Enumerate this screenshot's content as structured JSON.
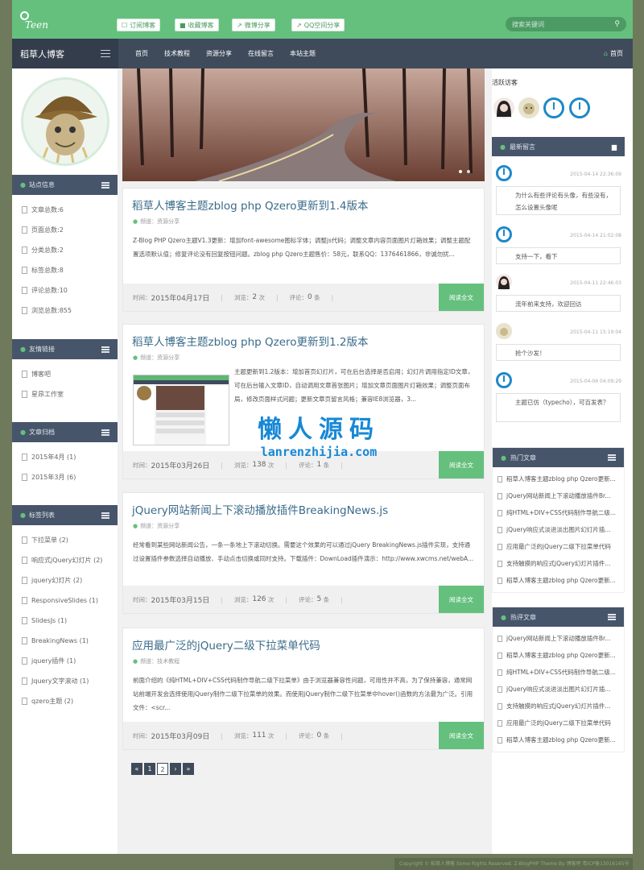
{
  "header": {
    "logo_text": "Teen",
    "buttons": [
      {
        "icon": "rss-icon",
        "label": "订阅博客"
      },
      {
        "icon": "bookmark-icon",
        "label": "收藏博客"
      },
      {
        "icon": "share-icon",
        "label": "微博分享"
      },
      {
        "icon": "share-icon",
        "label": "QQ空间分享"
      }
    ],
    "search_placeholder": "搜索关键词"
  },
  "nav": {
    "brand": "稻草人博客",
    "items": [
      "首页",
      "技术教程",
      "资源分享",
      "在线留言",
      "本站主题"
    ],
    "home": "首页"
  },
  "sidebar_left": {
    "site_info": {
      "title": "站点信息",
      "items": [
        "文章总数:6",
        "页面总数:2",
        "分类总数:2",
        "标签总数:8",
        "评论总数:10",
        "浏览总数:855"
      ]
    },
    "links": {
      "title": "友情链接",
      "items": [
        "博客吧",
        "星昂工作室"
      ]
    },
    "archive": {
      "title": "文章归档",
      "items": [
        "2015年4月 (1)",
        "2015年3月 (6)"
      ]
    },
    "tags": {
      "title": "标签列表",
      "items": [
        "下拉菜单 (2)",
        "响应式jQuery幻灯片 (2)",
        "jquery幻灯片 (2)",
        "ResponsiveSlides (1)",
        "SlidesJs (1)",
        "BreakingNews (1)",
        "jquery插件 (1)",
        "Jquery文字滚动 (1)",
        "qzero主题 (2)"
      ]
    }
  },
  "posts": [
    {
      "title": "稻草人博客主题zblog php Qzero更新到1.4版本",
      "category": "频道：资源分享",
      "body": "Z-Blog PHP Qzero主题V1.3更新：增加font-awesome图标字体；调整js代码；调整文章内容页面图片灯箱效果；调整主题配置选项默认值；修复评论没有回复按钮问题。zblog php Qzero主题售价：58元，联系QQ：1376461866，非诚勿扰...",
      "time_label": "时间：",
      "date": "2015年04月17日",
      "views_label": "浏览：",
      "views": "2",
      "views_unit": "次",
      "comments_label": "评论：",
      "comments": "0",
      "comments_unit": "条",
      "more": "阅读全文"
    },
    {
      "title": "稻草人博客主题zblog php Qzero更新到1.2版本",
      "category": "频道：资源分享",
      "body": "主题更新到1.2版本：增加首页幻灯片，可在后台选择是否启用；幻灯片调用指定ID文章，可在后台输入文章ID，自动调用文章首张图片；增加文章页面图片灯箱效果；调整页面布局，修改页面样式问题；更新文章页留言风格；兼容IE8浏览器，3...",
      "time_label": "时间：",
      "date": "2015年03月26日",
      "views_label": "浏览：",
      "views": "138",
      "views_unit": "次",
      "comments_label": "评论：",
      "comments": "1",
      "comments_unit": "条",
      "more": "阅读全文"
    },
    {
      "title": "jQuery网站新闻上下滚动播放插件BreakingNews.js",
      "category": "频道：资源分享",
      "body": "经常看到某些网站新闻公告，一条一条地上下滚动切换。需要这个效果的可以通过jQuery BreakingNews.js插件实现，支持通过设置插件参数选择自动播放、手动点击切换或同时支持。下载插件：DownLoad插件演示：http://www.xwcms.net/webA...",
      "time_label": "时间：",
      "date": "2015年03月15日",
      "views_label": "浏览：",
      "views": "126",
      "views_unit": "次",
      "comments_label": "评论：",
      "comments": "5",
      "comments_unit": "条",
      "more": "阅读全文"
    },
    {
      "title": "应用最广泛的jQuery二级下拉菜单代码",
      "category": "频道：技术教程",
      "body": "前面介绍的《纯HTML+DIV+CSS代码制作导航二级下拉菜单》由于浏览器兼容性问题，可用性并不高，为了保持兼容，通常网站前端开发会选择使用jQuery制作二级下拉菜单的效果。而使用jQuery制作二级下拉菜单中hover()函数的方法最为广泛。引用文件：<scr...",
      "time_label": "时间：",
      "date": "2015年03月09日",
      "views_label": "浏览：",
      "views": "111",
      "views_unit": "次",
      "comments_label": "评论：",
      "comments": "0",
      "comments_unit": "条",
      "more": "阅读全文"
    }
  ],
  "pager": [
    "«",
    "1",
    "2",
    "›",
    "»"
  ],
  "watermark": {
    "cn": "懒人源码",
    "en": "lanrenzhijia.com"
  },
  "sidebar_right": {
    "visitors_title": "活跃访客",
    "recent_comments_title": "最新留言",
    "comments": [
      {
        "time": "2015-04-14 22:36:09",
        "text": "为什么有些评论有头像，有些没有，怎么设置头像呢"
      },
      {
        "time": "2015-04-14 21:02:08",
        "text": "支持一下，看下"
      },
      {
        "time": "2015-04-11 22:46:03",
        "text": "流年前来支持，欢迎回访"
      },
      {
        "time": "2015-04-11 15:19:04",
        "text": "抢个沙发！"
      },
      {
        "time": "2015-04-06 04:09:29",
        "text": "主题已仿（typecho），可百发表？"
      }
    ],
    "hot_title": "热门文章",
    "hot": [
      "稻草人博客主题zblog php Qzero更新...",
      "jQuery网站新闻上下滚动播放插件Br...",
      "纯HTML+DIV+CSS代码制作导航二级...",
      "jQuery响应式淡进淡出图片幻灯片插...",
      "应用最广泛的jQuery二级下拉菜单代码",
      "支持触摸的响应式jQuery幻灯片插件...",
      "稻草人博客主题zblog php Qzero更新..."
    ],
    "hotcmt_title": "热评文章",
    "hotcmt": [
      "jQuery网站新闻上下滚动播放插件Br...",
      "稻草人博客主题zblog php Qzero更新...",
      "纯HTML+DIV+CSS代码制作导航二级...",
      "jQuery响应式淡进淡出图片幻灯片插...",
      "支持触摸的响应式jQuery幻灯片插件...",
      "应用最广泛的jQuery二级下拉菜单代码",
      "稻草人博客主题zblog php Qzero更新..."
    ]
  },
  "footer": "Copyright © 稻草人博客 Some Rights Reserved. Z-BlogPHP Theme By 博客吧 粤ICP备13016165号"
}
